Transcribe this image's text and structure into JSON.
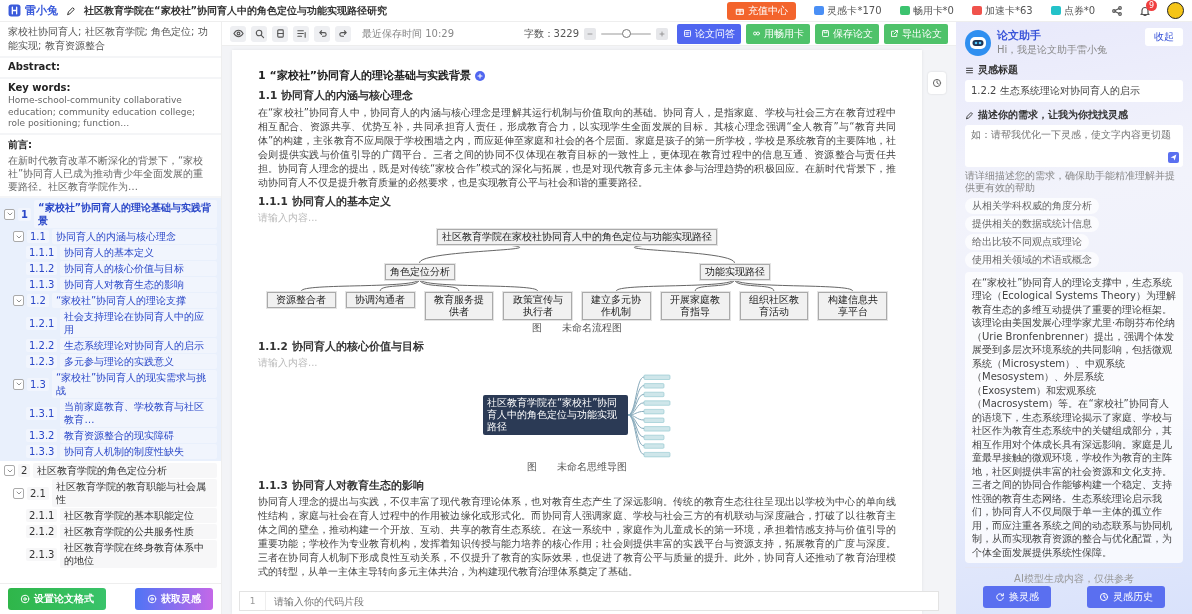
{
  "app": {
    "logo": "雷小兔",
    "title": "社区教育学院在“家校社”协同育人中的角色定位与功能实现路径研究"
  },
  "top_bar": {
    "recharge": "充值中心",
    "counters": [
      {
        "label": "灵感卡*170",
        "color": "#4a8ff5"
      },
      {
        "label": "畅用卡*0",
        "color": "#3cc36f"
      },
      {
        "label": "加速卡*63",
        "color": "#f0524c"
      },
      {
        "label": "点券*0",
        "color": "#23c2c9"
      }
    ],
    "notification_badge": "9"
  },
  "sidebar": {
    "keywords_text": "家校社协同育人; 社区教育学院; 角色定位; 功能实现; 教育资源整合",
    "abstract_label": "Abstract:",
    "key_words_label": "Key words:",
    "key_words_text": "Home-school-community collaborative education; community education college; role positioning; function…",
    "preface_label": "前言:",
    "preface_text": "在新时代教育改革不断深化的背景下，“家校社”协同育人已成为推动青少年全面发展的重要路径。社区教育学院作为…",
    "outline": [
      {
        "number": "1",
        "title": "“家校社”协同育人的理论基础与实践背景",
        "selected": true,
        "expanded": true,
        "children": [
          {
            "number": "1.1",
            "title": "协同育人的内涵与核心理念",
            "expanded": true,
            "children": [
              {
                "number": "1.1.1",
                "title": "协同育人的基本定义"
              },
              {
                "number": "1.1.2",
                "title": "协同育人的核心价值与目标"
              },
              {
                "number": "1.1.3",
                "title": "协同育人对教育生态的影响"
              }
            ]
          },
          {
            "number": "1.2",
            "title": "“家校社”协同育人的理论支撑",
            "expanded": true,
            "children": [
              {
                "number": "1.2.1",
                "title": "社会支持理论在协同育人中的应用"
              },
              {
                "number": "1.2.2",
                "title": "生态系统理论对协同育人的启示"
              },
              {
                "number": "1.2.3",
                "title": "多元参与理论的实践意义"
              }
            ]
          },
          {
            "number": "1.3",
            "title": "“家校社”协同育人的现实需求与挑战",
            "expanded": true,
            "children": [
              {
                "number": "1.3.1",
                "title": "当前家庭教育、学校教育与社区教育…"
              },
              {
                "number": "1.3.2",
                "title": "教育资源整合的现实障碍"
              },
              {
                "number": "1.3.3",
                "title": "协同育人机制的制度性缺失"
              }
            ]
          }
        ]
      },
      {
        "number": "2",
        "title": "社区教育学院的角色定位分析",
        "selected": false,
        "expanded": true,
        "children": [
          {
            "number": "2.1",
            "title": "社区教育学院的教育职能与社会属性",
            "expanded": true,
            "children": [
              {
                "number": "2.1.1",
                "title": "社区教育学院的基本职能定位"
              },
              {
                "number": "2.1.2",
                "title": "社区教育学院的公共服务性质"
              },
              {
                "number": "2.1.3",
                "title": "社区教育学院在终身教育体系中的地位"
              }
            ]
          }
        ]
      }
    ],
    "buttons": [
      {
        "label": "设置论文格式",
        "kind": "format"
      },
      {
        "label": "获取灵感",
        "kind": "inspire"
      }
    ]
  },
  "toolbar": {
    "save_time": "最近保存时间 10:29",
    "word_count": "字数：3229",
    "zoom": {
      "level": 0.5
    },
    "buttons": [
      {
        "label": "论文问答",
        "kind": "qa"
      },
      {
        "label": "用畅用卡",
        "kind": "card"
      },
      {
        "label": "保存论文",
        "kind": "save"
      },
      {
        "label": "导出论文",
        "kind": "export"
      }
    ]
  },
  "document": {
    "blocks": [
      {
        "kind": "h1",
        "text": "1 “家校社”协同育人的理论基础与实践背景"
      },
      {
        "kind": "h2",
        "text": "1.1 协同育人的内涵与核心理念"
      },
      {
        "kind": "p",
        "text": "在“家校社”协同育人中，协同育人的内涵与核心理念是理解其运行机制与价值取向的基础。协同育人，是指家庭、学校与社会三方在教育过程中相互配合、资源共享、优势互补，共同承担育人责任，形成教育合力，以实现学生全面发展的目标。其核心理念强调“全人教育”与“教育共同体”的构建，主张教育不应局限于学校围墙之内，而应延伸至家庭和社会的各个层面。家庭是孩子的第一所学校，学校是系统教育的主要阵地，社会则提供实践与价值引导的广阔平台。三者之间的协同不仅体现在教育目标的一致性上，更体现在教育过程中的信息互通、资源整合与责任共担。协同育人理念的提出，既是对传统“家校合作”模式的深化与拓展，也是对现代教育多元主体参与治理趋势的积极回应。在新时代背景下，推动协同育人不仅是提升教育质量的必然要求，也是实现教育公平与社会和谐的重要路径。"
      },
      {
        "kind": "h3",
        "text": "1.1.1 协同育人的基本定义"
      },
      {
        "kind": "placeholder",
        "text": "请输入内容..."
      },
      {
        "kind": "tree",
        "root": "社区教育学院在家校社协同育人中的角色定位与功能实现路径",
        "branches": [
          {
            "label": "角色定位分析",
            "leaves": [
              "资源整合者",
              "协调沟通者",
              "教育服务提供者",
              "政策宣传与执行者"
            ]
          },
          {
            "label": "功能实现路径",
            "leaves": [
              "建立多元协作机制",
              "开展家庭教育指导",
              "组织社区教育活动",
              "构建信息共享平台"
            ]
          }
        ]
      },
      {
        "kind": "caption",
        "text": "图　　未命名流程图"
      },
      {
        "kind": "h3",
        "text": "1.1.2 协同育人的核心价值与目标"
      },
      {
        "kind": "placeholder",
        "text": "请输入内容..."
      },
      {
        "kind": "mindmap",
        "root": "社区教育学院在“家校社”协同育人中的角色定位与功能实现路径"
      },
      {
        "kind": "caption",
        "text": "图　　未命名思维导图"
      },
      {
        "kind": "h3",
        "text": "1.1.3 协同育人对教育生态的影响"
      },
      {
        "kind": "p",
        "text": "协同育人理念的提出与实践，不仅丰富了现代教育理论体系，也对教育生态产生了深远影响。传统的教育生态往往呈现出以学校为中心的单向线性结构，家庭与社会在育人过程中的作用被边缘化或形式化。而协同育人强调家庭、学校与社会三方的有机联动与深度融合，打破了以往教育主体之间的壁垒，推动构建一个开放、互动、共享的教育生态系统。在这一系统中，家庭作为儿童成长的第一环境，承担着情感支持与价值引导的重要功能；学校作为专业教育机构，发挥着知识传授与能力培养的核心作用；社会则提供丰富的实践平台与资源支持，拓展教育的广度与深度。三者在协同育人机制下形成良性互动关系，不仅提升了教育的实际效果，也促进了教育公平与质量的提升。此外，协同育人还推动了教育治理模式的转型，从单一主体主导转向多元主体共治，为构建现代教育治理体系奠定了基础。"
      }
    ],
    "code_line_number": "1",
    "code_placeholder": "请输入你的代码片段"
  },
  "assistant": {
    "title": "论文助手",
    "subtitle": "Hi，我是论文助手雷小兔",
    "collapse": "收起",
    "topic_label": "灵感标题",
    "topic_value": "1.2.2 生态系统理论对协同育人的启示",
    "prompt_label": "描述你的需求，让我为你找找灵感",
    "prompt_placeholder": "如：请帮我优化一下灵感，使文字内容更切题",
    "hint": "请详细描述您的需求，确保助手能精准理解并提供更有效的帮助",
    "suggestions": [
      "从相关学科权威的角度分析",
      "提供相关的数据或统计信息",
      "给出比较不同观点或理论",
      "使用相关领域的术语或概念"
    ],
    "answer": "在“家校社”协同育人的理论支撑中，生态系统理论（Ecological Systems Theory）为理解教育生态的多维互动提供了重要的理论框架。该理论由美国发展心理学家尤里·布朗芬布伦纳（Urie Bronfenbrenner）提出，强调个体发展受到多层次环境系统的共同影响，包括微观系统（Microsystem）、中观系统（Mesosystem）、外层系统（Exosystem）和宏观系统（Macrosystem）等。在“家校社”协同育人的语境下，生态系统理论揭示了家庭、学校与社区作为教育生态系统中的关键组成部分，其相互作用对个体成长具有深远影响。家庭是儿童最早接触的微观环境，学校作为教育的主阵地，社区则提供丰富的社会资源和文化支持。三者之间的协同合作能够构建一个稳定、支持性强的教育生态网络。生态系统理论启示我们，协同育人不仅局限于单一主体的孤立作用，而应注重各系统之间的动态联系与协同机制，从而实现教育资源的整合与优化配置，为个体全面发展提供系统性保障。",
    "disclaimer": "AI模型生成内容，仅供参考",
    "buttons": [
      {
        "label": "换灵感",
        "kind": "refresh"
      },
      {
        "label": "灵感历史",
        "kind": "history"
      }
    ]
  }
}
